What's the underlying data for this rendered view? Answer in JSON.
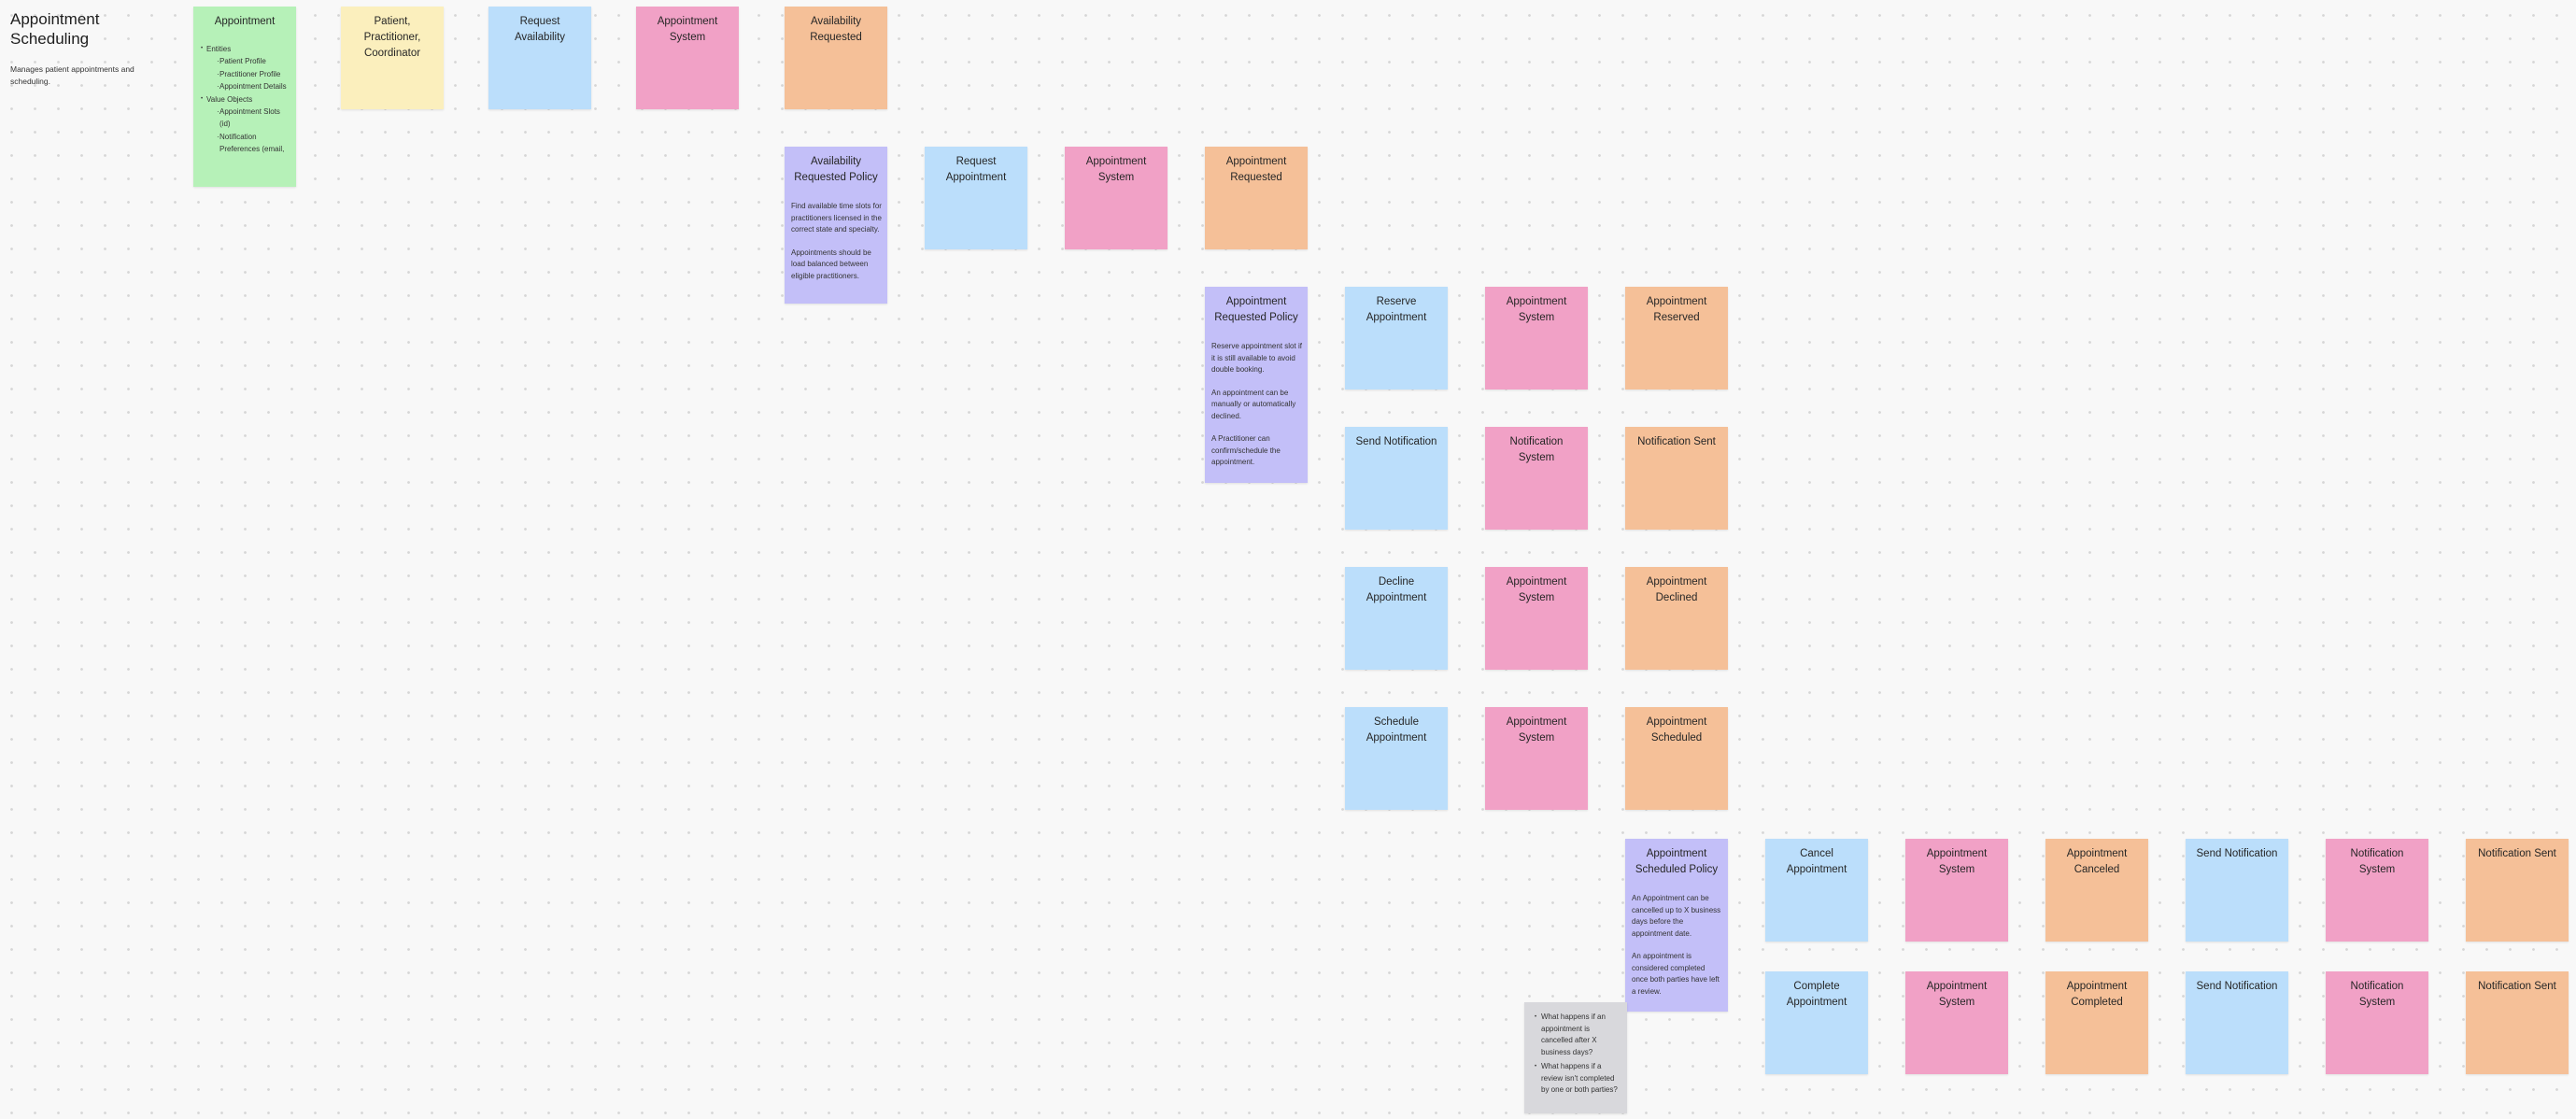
{
  "board": {
    "title": "Appointment Scheduling",
    "description": "Manages patient appointments and scheduling."
  },
  "legend_colors": {
    "command": "#bbdefb",
    "actor": "#fbefbd",
    "system": "#f1a1c6",
    "event": "#f5c098",
    "policy": "#c3bff8",
    "aggregate": "#b6f1b8",
    "question": "#d8d8dc"
  },
  "aggregate": {
    "title": "Appointment",
    "entities_label": "Entities",
    "entities": [
      "Patient Profile",
      "Practitioner Profile",
      "Appointment Details"
    ],
    "value_objects_label": "Value Objects",
    "value_objects": [
      "Appointment Slots (id)",
      "Notification Preferences (email,"
    ]
  },
  "row1": {
    "actor": "Patient, Practitioner, Coordinator",
    "command": "Request Availability",
    "system": "Appointment System",
    "event": "Availability Requested"
  },
  "row2": {
    "policy_title": "Availability Requested Policy",
    "policy_body": [
      "Find available time slots for practitioners licensed in the correct state and specialty.",
      "Appointments should be load balanced between eligible practitioners."
    ],
    "command": "Request Appointment",
    "system": "Appointment System",
    "event": "Appointment Requested"
  },
  "row3": {
    "policy_title": "Appointment Requested Policy",
    "policy_body": [
      "Reserve appointment slot if it is still available to avoid double booking.",
      "An appointment can be manually or automatically declined.",
      "A Practitioner can confirm/schedule the appointment."
    ],
    "command": "Reserve Appointment",
    "system": "Appointment System",
    "event": "Appointment Reserved"
  },
  "row4": {
    "command": "Send Notification",
    "system": "Notification System",
    "event": "Notification Sent"
  },
  "row5": {
    "command": "Decline Appointment",
    "system": "Appointment System",
    "event": "Appointment Declined"
  },
  "row6": {
    "command": "Schedule Appointment",
    "system": "Appointment System",
    "event": "Appointment Scheduled"
  },
  "row7": {
    "policy_title": "Appointment Scheduled Policy",
    "policy_body": [
      "An Appointment can be cancelled up to X business days before the appointment date.",
      "An appointment is considered completed once both parties have left a review."
    ],
    "command": "Cancel Appointment",
    "system": "Appointment System",
    "event": "Appointment Canceled",
    "notify_command": "Send Notification",
    "notify_system": "Notification System",
    "notify_event": "Notification Sent"
  },
  "row8": {
    "command": "Complete Appointment",
    "system": "Appointment System",
    "event": "Appointment Completed",
    "notify_command": "Send Notification",
    "notify_system": "Notification System",
    "notify_event": "Notification Sent"
  },
  "questions": [
    "What happens if an appointment is cancelled after X business days?",
    "What happens if a review isn't completed by one or both parties?"
  ]
}
